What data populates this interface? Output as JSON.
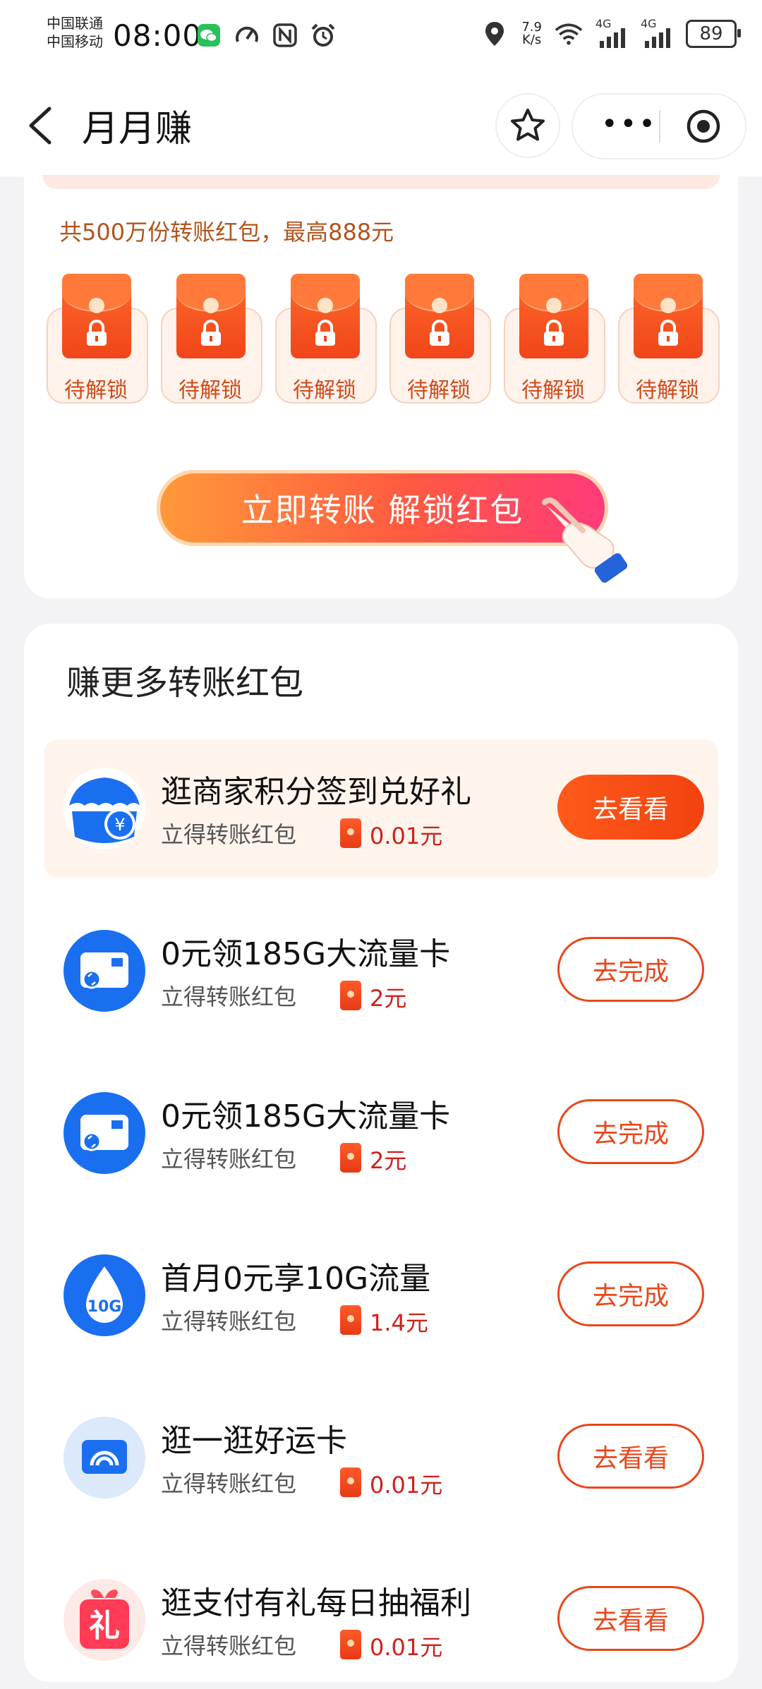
{
  "status_bar": {
    "carrier_1": "中国联通",
    "carrier_2": "中国移动",
    "time": "08:00",
    "speed_value": "7.9",
    "speed_unit": "K/s",
    "net_1": "4G",
    "net_2": "4G",
    "battery": "89"
  },
  "header": {
    "title": "月月赚"
  },
  "unlock_section": {
    "subtitle": "共500万份转账红包，最高888元",
    "packets": [
      {
        "label": "待解锁"
      },
      {
        "label": "待解锁"
      },
      {
        "label": "待解锁"
      },
      {
        "label": "待解锁"
      },
      {
        "label": "待解锁"
      },
      {
        "label": "待解锁"
      }
    ],
    "cta_label": "立即转账 解锁红包"
  },
  "earn_more": {
    "title": "赚更多转账红包",
    "tasks": [
      {
        "name": "逛商家积分签到兑好礼",
        "sub": "立得转账红包",
        "amount": "0.01元",
        "button": "去看看",
        "icon": "merchant-umbrella-icon"
      },
      {
        "name": "0元领185G大流量卡",
        "sub": "立得转账红包",
        "amount": "2元",
        "button": "去完成",
        "icon": "sim-card-icon"
      },
      {
        "name": "0元领185G大流量卡",
        "sub": "立得转账红包",
        "amount": "2元",
        "button": "去完成",
        "icon": "sim-card-icon"
      },
      {
        "name": "首月0元享10G流量",
        "sub": "立得转账红包",
        "amount": "1.4元",
        "button": "去完成",
        "icon": "data-drop-icon",
        "icon_text": "10G"
      },
      {
        "name": "逛一逛好运卡",
        "sub": "立得转账红包",
        "amount": "0.01元",
        "button": "去看看",
        "icon": "lucky-card-icon"
      },
      {
        "name": "逛支付有礼每日抽福利",
        "sub": "立得转账红包",
        "amount": "0.01元",
        "button": "去看看",
        "icon": "gift-icon",
        "icon_text": "礼"
      }
    ]
  },
  "colors": {
    "accent": "#e8471a",
    "amount": "#d0201a",
    "subtitle": "#b2541f",
    "icon_blue": "#1a6ff0"
  }
}
